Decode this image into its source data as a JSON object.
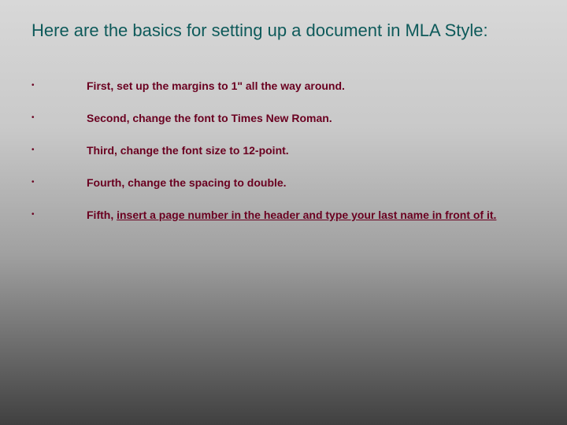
{
  "title": "Here are the basics for setting up a document in MLA Style:",
  "bullets": [
    {
      "dot": "•",
      "text": "First, set up the margins to 1\" all the way around."
    },
    {
      "dot": "•",
      "text": "Second, change the font to Times New Roman."
    },
    {
      "dot": "•",
      "text": "Third, change the font size to 12-point."
    },
    {
      "dot": "•",
      "text": "Fourth, change the spacing to double."
    },
    {
      "dot": "•",
      "prefix": "Fifth, ",
      "underlined": "insert a page number in the header and type your last name in front of it."
    }
  ]
}
